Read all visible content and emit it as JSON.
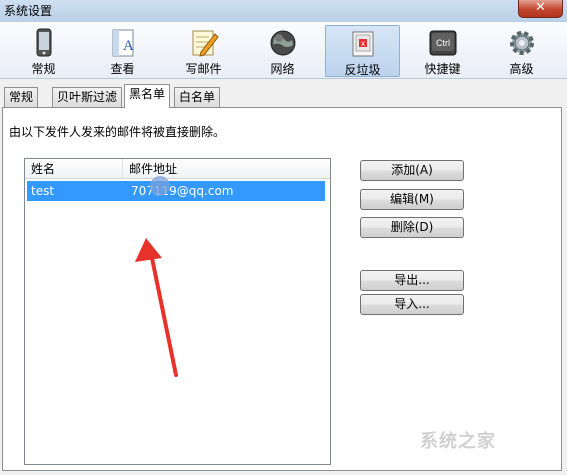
{
  "window": {
    "title": "系统设置"
  },
  "toolbar": {
    "items": [
      {
        "label": "常规",
        "icon": "phone-icon"
      },
      {
        "label": "查看",
        "icon": "document-view-icon"
      },
      {
        "label": "写邮件",
        "icon": "notepad-pencil-icon"
      },
      {
        "label": "网络",
        "icon": "network-globe-icon"
      },
      {
        "label": "反垃圾",
        "icon": "antispam-icon",
        "selected": true
      },
      {
        "label": "快捷键",
        "icon": "ctrl-key-icon"
      },
      {
        "label": "高级",
        "icon": "gear-icon"
      }
    ],
    "ctrl_key_text": "Ctrl"
  },
  "tabs": [
    {
      "label": "常规"
    },
    {
      "label": "贝叶斯过滤"
    },
    {
      "label": "黑名单",
      "selected": true
    },
    {
      "label": "白名单"
    }
  ],
  "blacklist": {
    "description": "由以下发件人发来的邮件将被直接删除。",
    "columns": [
      "姓名",
      "邮件地址"
    ],
    "rows": [
      {
        "name": "test",
        "email": "707119@qq.com",
        "selected": true
      }
    ]
  },
  "buttons": {
    "add": "添加(A)",
    "edit": "编辑(M)",
    "delete": "删除(D)",
    "export": "导出...",
    "import": "导入..."
  },
  "watermark": "系统之家",
  "colors": {
    "selection": "#3399ff",
    "annotation_arrow": "#e8312b"
  }
}
